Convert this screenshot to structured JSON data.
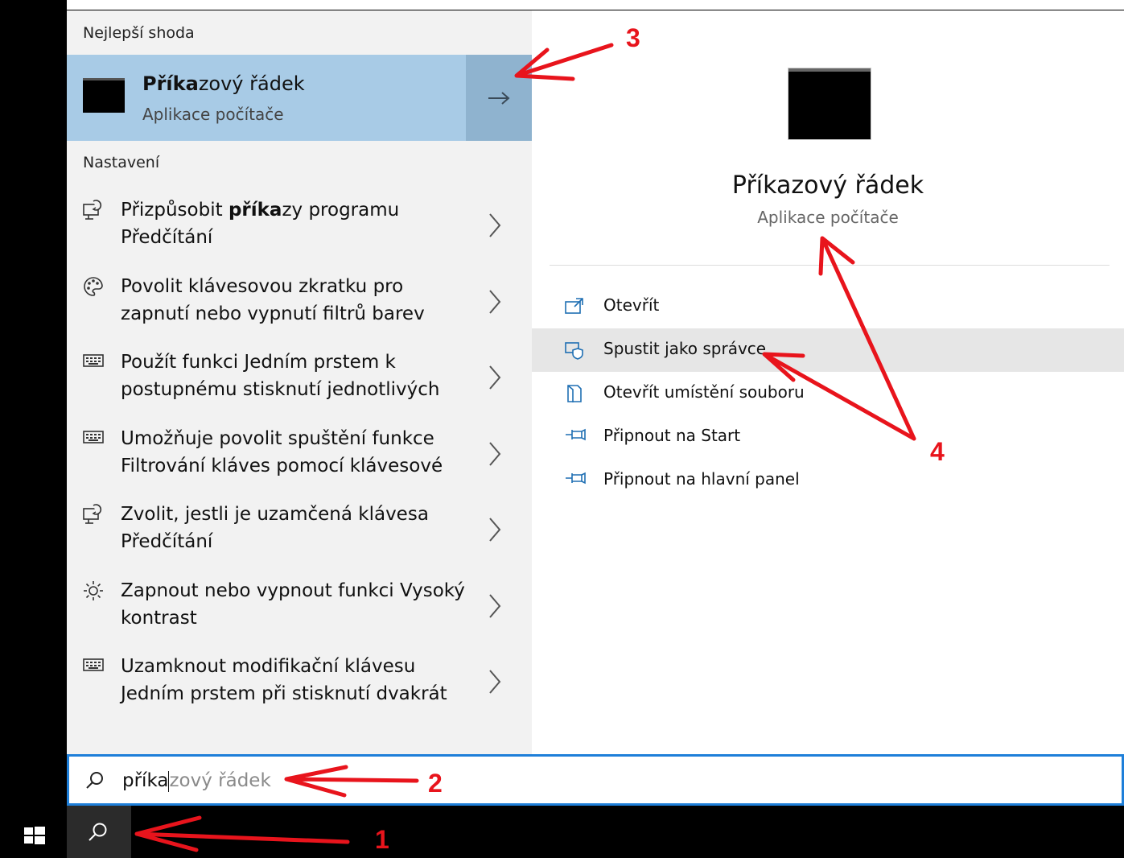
{
  "left_panel": {
    "best_match_heading": "Nejlepší shoda",
    "best_match": {
      "title_bold": "Příka",
      "title_rest": "zový řádek",
      "subtitle": "Aplikace počítače"
    },
    "settings_heading": "Nastavení",
    "settings_items": [
      {
        "icon": "narrator-icon",
        "pre": "Přizpůsobit ",
        "bold": "příka",
        "post": "zy programu",
        "line2": "Předčítání"
      },
      {
        "icon": "palette-icon",
        "pre": "Povolit klávesovou zkratku pro",
        "bold": "",
        "post": "",
        "line2": "zapnutí nebo vypnutí filtrů barev"
      },
      {
        "icon": "keyboard-icon",
        "pre": "Použít funkci Jedním prstem k",
        "bold": "",
        "post": "",
        "line2": "postupnému stisknutí jednotlivých"
      },
      {
        "icon": "keyboard-icon",
        "pre": "Umožňuje povolit spuštění funkce",
        "bold": "",
        "post": "",
        "line2": "Filtrování kláves pomocí klávesové"
      },
      {
        "icon": "narrator-icon",
        "pre": "Zvolit, jestli je uzamčená klávesa",
        "bold": "",
        "post": "",
        "line2": "Předčítání"
      },
      {
        "icon": "brightness-icon",
        "pre": "Zapnout nebo vypnout funkci Vysoký",
        "bold": "",
        "post": "",
        "line2": "kontrast"
      },
      {
        "icon": "keyboard-icon",
        "pre": "Uzamknout modifikační klávesu",
        "bold": "",
        "post": "",
        "line2": "Jedním prstem při stisknutí dvakrát"
      }
    ]
  },
  "right_panel": {
    "title": "Příkazový řádek",
    "subtitle": "Aplikace počítače",
    "actions": [
      {
        "icon": "open-icon",
        "label": "Otevřít"
      },
      {
        "icon": "admin-shield-icon",
        "label": "Spustit jako správce"
      },
      {
        "icon": "file-location-icon",
        "label": "Otevřít umístění souboru"
      },
      {
        "icon": "pin-icon",
        "label": "Připnout na Start"
      },
      {
        "icon": "pin-icon",
        "label": "Připnout na hlavní panel"
      }
    ]
  },
  "search": {
    "typed": "příka",
    "suggestion": "zový řádek"
  },
  "annotations": {
    "n1": "1",
    "n2": "2",
    "n3": "3",
    "n4": "4",
    "arrow_color": "#e8141c"
  },
  "colors": {
    "accent": "#1e7fd9",
    "best_match_bg": "#a8cbe6",
    "icon_blue": "#1f6fb3"
  }
}
